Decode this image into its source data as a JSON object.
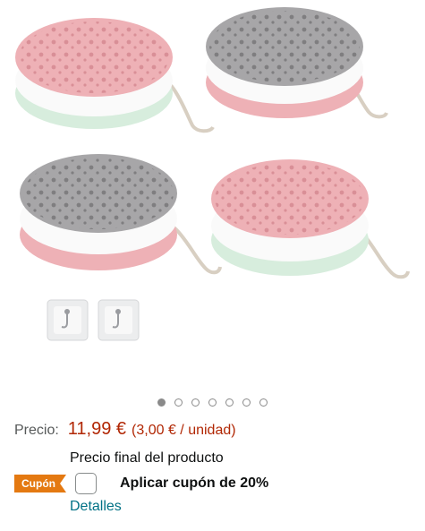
{
  "gallery": {
    "sponges": [
      {
        "color": "pink-white-green"
      },
      {
        "color": "gray-white-pink"
      },
      {
        "color": "gray-white-pink"
      },
      {
        "color": "pink-white-green"
      }
    ],
    "hook_thumbnails": 2,
    "carousel": {
      "total": 7,
      "active": 1
    }
  },
  "price": {
    "label": "Precio:",
    "value": "11,99 €",
    "unit": "(3,00 € / unidad)",
    "final_note": "Precio final del producto"
  },
  "coupon": {
    "badge": "Cupón",
    "text": "Aplicar cupón de 20%"
  },
  "details_link": "Detalles",
  "colors": {
    "price": "#B12704",
    "link": "#007185",
    "coupon_badge": "#E47911",
    "pink": "#EEB1B6",
    "gray": "#A7A6A8",
    "mint": "#D7EDDD"
  }
}
